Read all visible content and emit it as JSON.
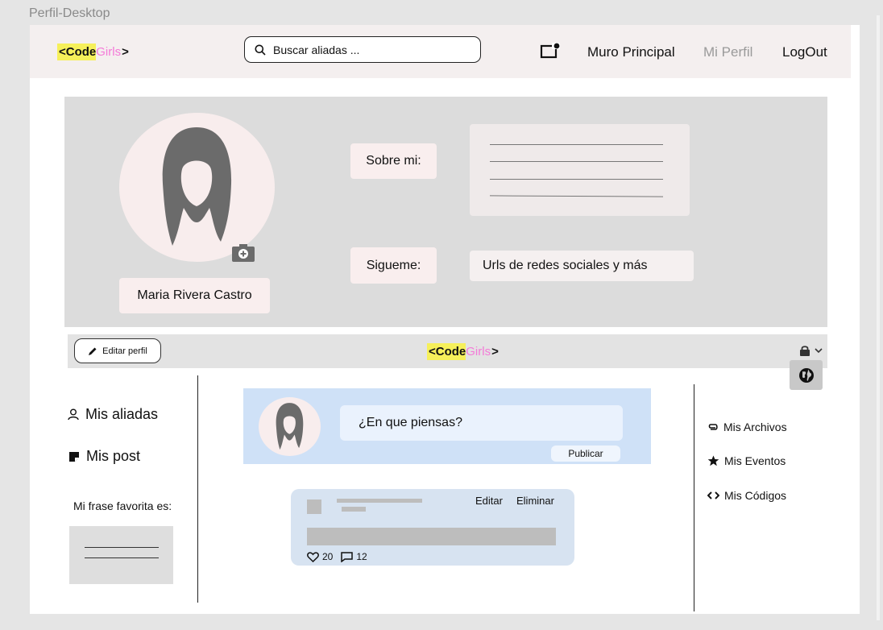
{
  "frame_label": "Perfil-Desktop",
  "header": {
    "logo": {
      "code": "<Code",
      "girls": "Girls",
      "end": ">"
    },
    "search_placeholder": "Buscar aliadas ...",
    "nav": {
      "muro": "Muro Principal",
      "perfil": "Mi Perfil",
      "logout": "LogOut"
    }
  },
  "profile": {
    "name": "Maria Rivera Castro",
    "about_label": "Sobre mi:",
    "follow_label": "Sigueme:",
    "urls_text": "Urls de redes sociales y más"
  },
  "toolbar": {
    "edit_label": "Editar perfil",
    "logo": {
      "code": "<Code",
      "girls": "Girls",
      "end": ">"
    }
  },
  "left_sidebar": {
    "aliadas": "Mis aliadas",
    "posts": "Mis post",
    "fav_label": "Mi frase favorita es:"
  },
  "composer": {
    "placeholder": "¿En que piensas?",
    "publish": "Publicar"
  },
  "post": {
    "edit": "Editar",
    "delete": "Eliminar",
    "likes": "20",
    "comments": "12"
  },
  "right_sidebar": {
    "archivos": "Mis Archivos",
    "eventos": "Mis Eventos",
    "codigos": "Mis Códigos"
  },
  "colors": {
    "header_bg": "#f4efef",
    "logo_highlight": "#f6f05a",
    "logo_girls": "#f47ad8",
    "composer_bg": "#cfe1f7",
    "post_bg": "#d7e3f1",
    "panel_bg": "#dcdcdc"
  }
}
